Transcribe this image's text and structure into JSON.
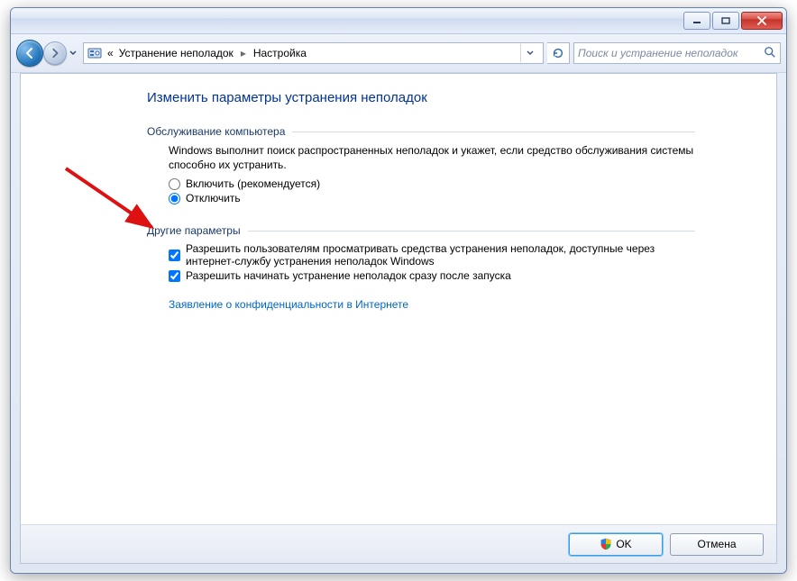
{
  "breadcrumb": {
    "prefix": "«",
    "item1": "Устранение неполадок",
    "item2": "Настройка"
  },
  "search": {
    "placeholder": "Поиск и устранение неполадок"
  },
  "page": {
    "title": "Изменить параметры устранения неполадок"
  },
  "group1": {
    "title": "Обслуживание компьютера",
    "desc": "Windows выполнит поиск распространенных неполадок и укажет, если средство обслуживания системы способно их устранить.",
    "opt_on": "Включить (рекомендуется)",
    "opt_off": "Отключить"
  },
  "group2": {
    "title": "Другие параметры",
    "chk1": "Разрешить пользователям просматривать средства устранения неполадок, доступные через интернет-службу устранения неполадок Windows",
    "chk2": "Разрешить начинать устранение неполадок сразу после запуска"
  },
  "privacy_link": "Заявление о конфиденциальности в Интернете",
  "buttons": {
    "ok": "OK",
    "cancel": "Отмена"
  },
  "state": {
    "radio_selected": "off",
    "chk1": true,
    "chk2": true
  }
}
